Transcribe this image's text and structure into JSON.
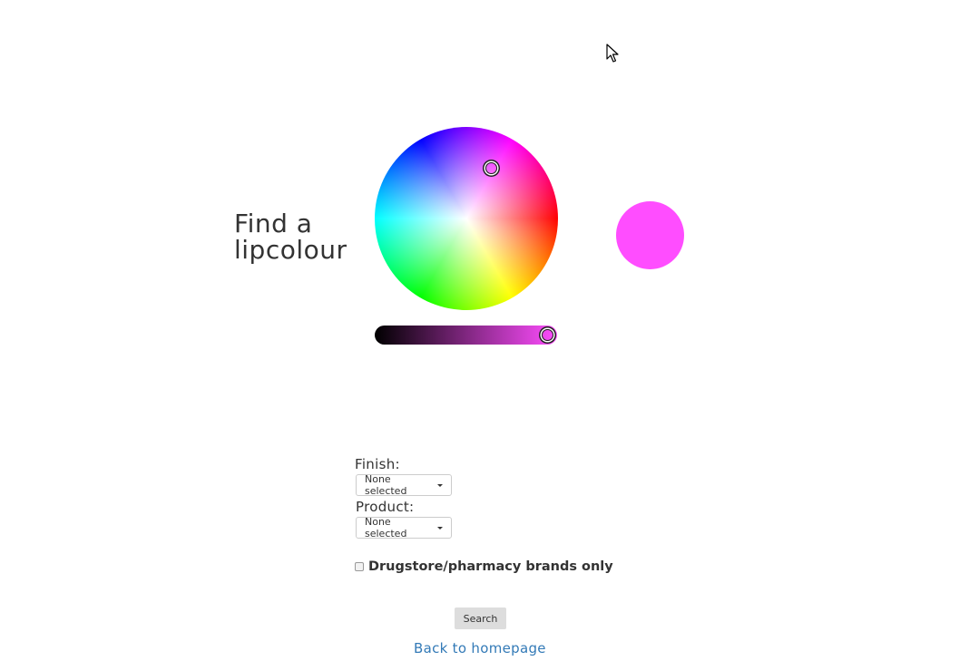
{
  "heading": {
    "line1": "Find a",
    "line2": "lipcolour"
  },
  "picker": {
    "selected_color": "#ff4dff",
    "brightness_fraction": 0.95
  },
  "filters": {
    "finish_label": "Finish:",
    "finish_value": "None selected",
    "product_label": "Product:",
    "product_value": "None selected"
  },
  "drugstore": {
    "label": "Drugstore/pharmacy brands only",
    "checked": false
  },
  "actions": {
    "search_label": "Search",
    "back_label": "Back to homepage"
  },
  "icons": {
    "cursor": "mouse-pointer-icon",
    "caret": "caret-down-icon"
  },
  "colors": {
    "link": "#337ab7",
    "text": "#333333",
    "button_bg": "#dddddd"
  }
}
